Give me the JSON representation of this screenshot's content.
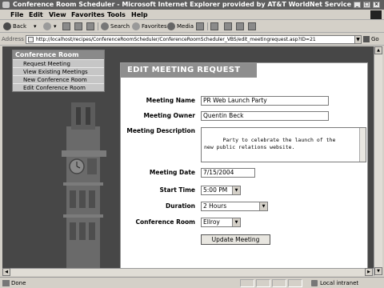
{
  "window": {
    "title": "Conference Room Scheduler - Microsoft Internet Explorer provided by AT&T WorldNet Service"
  },
  "menubar": {
    "items": [
      "File",
      "Edit",
      "View",
      "Favorites",
      "Tools",
      "Help"
    ]
  },
  "toolbar": {
    "back_label": "Back",
    "search_label": "Search",
    "favorites_label": "Favorites",
    "media_label": "Media"
  },
  "address": {
    "label": "Address",
    "url": "http://localhost/recipes/ConferenceRoomScheduler/ConferenceRoomScheduler_VBS/edit_meetingrequest.asp?ID=21",
    "go_label": "Go"
  },
  "nav": {
    "title": "Conference Room",
    "items": [
      "Request Meeting",
      "View Existing Meetings",
      "New Conference Room",
      "Edit Conference Room"
    ]
  },
  "form": {
    "header": "EDIT MEETING REQUEST",
    "meeting_name_label": "Meeting Name",
    "meeting_name_value": "PR Web Launch Party",
    "meeting_owner_label": "Meeting Owner",
    "meeting_owner_value": "Quentin Beck",
    "meeting_description_label": "Meeting Description",
    "meeting_description_value": "Party to celebrate the launch of the\nnew public relations website.",
    "meeting_date_label": "Meeting Date",
    "meeting_date_value": "7/15/2004",
    "start_time_label": "Start Time",
    "start_time_value": "5:00 PM",
    "duration_label": "Duration",
    "duration_value": "2 Hours",
    "conference_room_label": "Conference Room",
    "conference_room_value": "Ellroy",
    "update_button": "Update Meeting"
  },
  "statusbar": {
    "status": "Done",
    "zone": "Local intranet"
  },
  "colors": {
    "page_background": "#474747",
    "panel_header": "#8e8e8e",
    "nav_title": "#8a8a8a"
  }
}
